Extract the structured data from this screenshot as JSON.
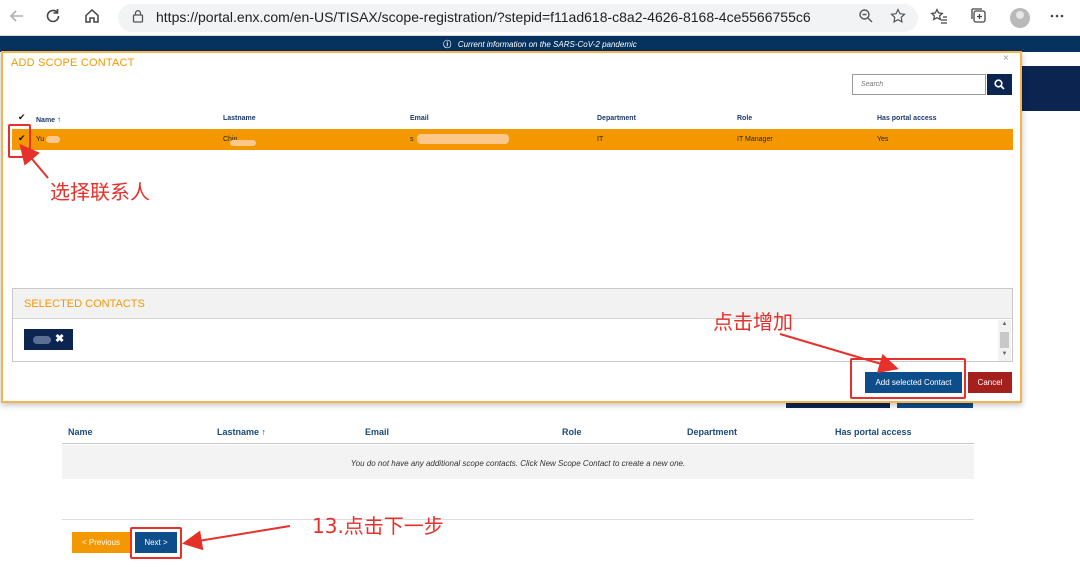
{
  "browser": {
    "url": "https://portal.enx.com/en-US/TISAX/scope-registration/?stepid=f11ad618-c8a2-4626-8168-4ce5566755c6"
  },
  "banner": {
    "text": "Current information on the SARS-CoV-2 pandemic"
  },
  "modal": {
    "title": "ADD SCOPE CONTACT",
    "close": "×",
    "search_placeholder": "Search",
    "columns": {
      "check": "✔",
      "name": "Name",
      "sort_indicator": "🠙",
      "lastname": "Lastname",
      "email": "Email",
      "department": "Department",
      "role": "Role",
      "portal_access": "Has portal access"
    },
    "rows": [
      {
        "checked": "✔",
        "name": "Yu",
        "lastname": "Chin",
        "email": "s",
        "department": "IT",
        "role": "IT Manager",
        "portal_access": "Yes"
      }
    ],
    "selected_title": "SELECTED CONTACTS",
    "chip_remove": "✖",
    "add_button": "Add selected Contact",
    "cancel_button": "Cancel"
  },
  "page": {
    "columns": {
      "name": "Name",
      "lastname": "Lastname",
      "sort_indicator": "🠙",
      "email": "Email",
      "role": "Role",
      "department": "Department",
      "portal_access": "Has portal access"
    },
    "empty_message": "You do not have any additional scope contacts. Click New Scope Contact to create a new one.",
    "prev_button": "< Previous",
    "next_button": "Next >"
  },
  "annotations": {
    "select_contact": "选择联系人",
    "click_add": "点击增加",
    "next_step": "13.点击下一步",
    "color": "#e8302a"
  },
  "colors": {
    "accent_orange": "#f39800",
    "navy": "#0c2550",
    "button_blue": "#0c4d8a",
    "cancel_red": "#a3201d"
  }
}
